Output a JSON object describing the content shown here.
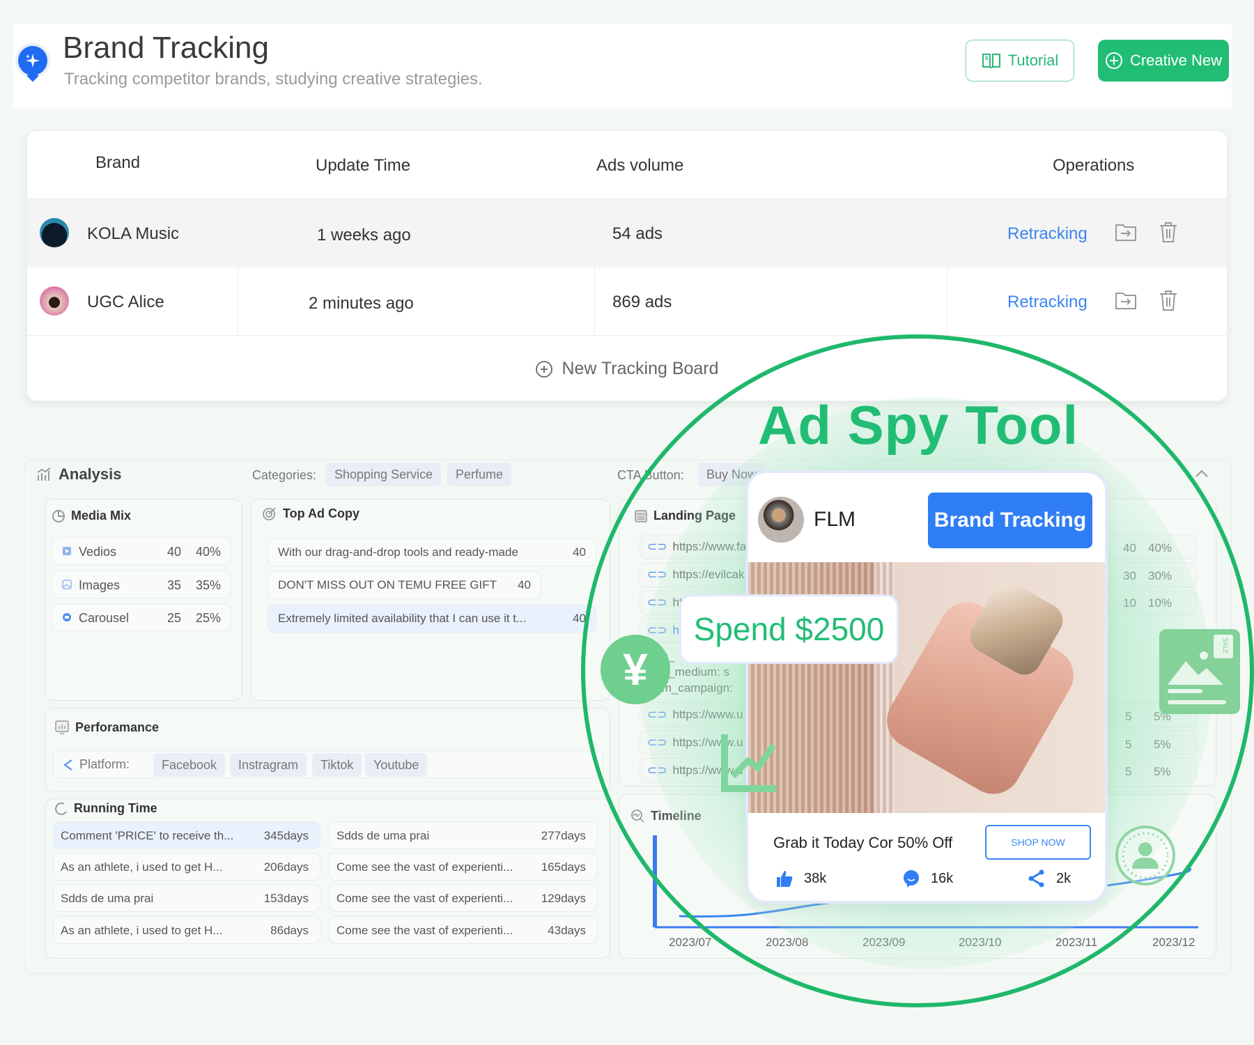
{
  "header": {
    "title": "Brand Tracking",
    "subtitle": "Tracking competitor brands, studying creative strategies.",
    "tutorial_label": "Tutorial",
    "create_label": "Creative New"
  },
  "table": {
    "columns": [
      "Brand",
      "Update Time",
      "Ads volume",
      "Operations"
    ],
    "rows": [
      {
        "brand": "KOLA Music",
        "update_time": "1 weeks ago",
        "ads_volume": "54 ads",
        "action": "Retracking"
      },
      {
        "brand": "UGC Alice",
        "update_time": "2 minutes ago",
        "ads_volume": "869 ads",
        "action": "Retracking"
      }
    ],
    "new_board_label": "New Tracking Board"
  },
  "analysis": {
    "title": "Analysis",
    "categories_label": "Categories:",
    "categories": [
      "Shopping Service",
      "Perfume"
    ],
    "cta_label": "CTA Button:",
    "cta_options": [
      "Buy Now"
    ],
    "media_mix": {
      "title": "Media Mix",
      "items": [
        {
          "label": "Vedios",
          "count": "40",
          "pct": "40%"
        },
        {
          "label": "Images",
          "count": "35",
          "pct": "35%"
        },
        {
          "label": "Carousel",
          "count": "25",
          "pct": "25%"
        }
      ]
    },
    "top_ad_copy": {
      "title": "Top Ad Copy",
      "items": [
        {
          "text": "With our drag-and-drop tools and ready-made",
          "count": "40"
        },
        {
          "text": "DON'T MISS OUT ON TEMU FREE GIFT",
          "count": "40"
        },
        {
          "text": "Extremely limited availability that I can use it t...",
          "count": "40"
        }
      ]
    },
    "landing_page": {
      "title": "Landing Page",
      "items": [
        {
          "url": "https://www.fa",
          "count": "40",
          "pct": "40%"
        },
        {
          "url": "https://evilcak",
          "count": "30",
          "pct": "30%"
        },
        {
          "url": "htt",
          "count": "10",
          "pct": "10%"
        },
        {
          "url": "htt",
          "count": "",
          "pct": ""
        },
        {
          "url": "https://www.u",
          "count": "5",
          "pct": "5%"
        },
        {
          "url": "https://www.u",
          "count": "5",
          "pct": "5%"
        },
        {
          "url": "https://www.u",
          "count": "5",
          "pct": "5%"
        }
      ],
      "utm_lines": [
        "m_",
        "m_medium: s",
        "tm_campaign:"
      ]
    },
    "performance": {
      "title": "Perforamance",
      "platform_label": "Platform:",
      "platforms": [
        "Facebook",
        "Instragram",
        "Tiktok",
        "Youtube"
      ]
    },
    "running_time": {
      "title": "Running Time",
      "left": [
        {
          "text": "Comment 'PRICE' to receive th...",
          "days": "345days"
        },
        {
          "text": "As an athlete, i used to get H...",
          "days": "206days"
        },
        {
          "text": "Sdds de uma prai",
          "days": "153days"
        },
        {
          "text": "As an athlete, i used to get H...",
          "days": "86days"
        }
      ],
      "right": [
        {
          "text": "Sdds de uma prai",
          "days": "277days"
        },
        {
          "text": "Come see the vast of experienti...",
          "days": "165days"
        },
        {
          "text": "Come see the vast of experienti...",
          "days": "129days"
        },
        {
          "text": "Come see the vast of experienti...",
          "days": "43days"
        }
      ]
    },
    "timeline": {
      "title": "Timeline",
      "x_labels": [
        "2023/07",
        "2023/08",
        "2023/09",
        "2023/10",
        "2023/11",
        "2023/12"
      ]
    }
  },
  "overlay": {
    "headline": "Ad Spy Tool",
    "spend_label": "Spend $2500",
    "currency_glyph": "¥",
    "ad_card": {
      "brand": "FLM",
      "button_label": "Brand Tracking",
      "caption": "Grab it Today Cor 50% Off",
      "cta_label": "SHOP NOW",
      "likes": "38k",
      "comments": "16k",
      "shares": "2k"
    }
  },
  "colors": {
    "accent_green": "#22bd75",
    "link_blue": "#3a86f2",
    "brand_blue": "#2f7ef5"
  }
}
